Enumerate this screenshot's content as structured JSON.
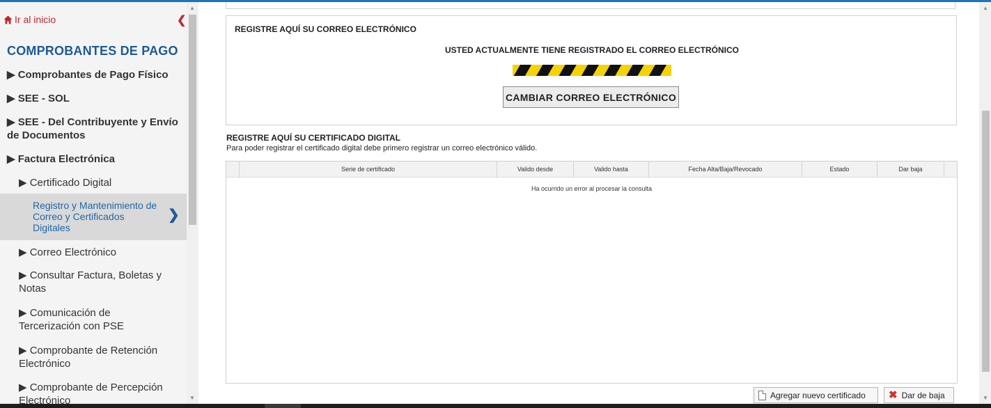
{
  "sidebar": {
    "home_label": "Ir al inicio",
    "section_title": "COMPROBANTES DE PAGO",
    "items": [
      {
        "label": "▶ Comprobantes de Pago Físico"
      },
      {
        "label": "▶ SEE - SOL"
      },
      {
        "label": "▶ SEE - Del Contribuyente y Envío de Documentos"
      },
      {
        "label": "▶ Factura Electrónica"
      }
    ],
    "sub_items": [
      {
        "label": "▶ Certificado Digital"
      },
      {
        "label": "▶ Correo Electrónico"
      },
      {
        "label": "▶ Consultar Factura, Boletas y Notas"
      },
      {
        "label": "▶ Comunicación de Tercerización con PSE"
      },
      {
        "label": "▶ Comprobante de Retención Electrónico"
      },
      {
        "label": "▶ Comprobante de Percepción Electrónico"
      }
    ],
    "active_item": "Registro y Mantenimiento de Correo y Certificados Digitales"
  },
  "email_section": {
    "title": "REGISTRE AQUÍ SU CORREO ELECTRÓNICO",
    "message": "USTED ACTUALMENTE TIENE REGISTRADO EL CORREO ELECTRÓNICO",
    "change_button": "CAMBIAR CORREO ELECTRÓNICO"
  },
  "cert_section": {
    "title": "REGISTRE AQUÍ SU CERTIFICADO DIGITAL",
    "note": "Para poder registrar el certificado digital debe primero registrar un correo electrónico válido.",
    "columns": [
      "Serie de certificado",
      "Valido desde",
      "Valido hasta",
      "Fecha Alta/Baja/Revocado",
      "Estado",
      "Dar baja"
    ],
    "empty_message": "Ha ocurrido un error al procesar la consulta",
    "add_button": "Agregar nuevo certificado",
    "delete_button": "Dar de baja"
  },
  "colors": {
    "accent_red": "#c0272d",
    "title_blue": "#1e5a96",
    "link_blue": "#2067a8"
  }
}
